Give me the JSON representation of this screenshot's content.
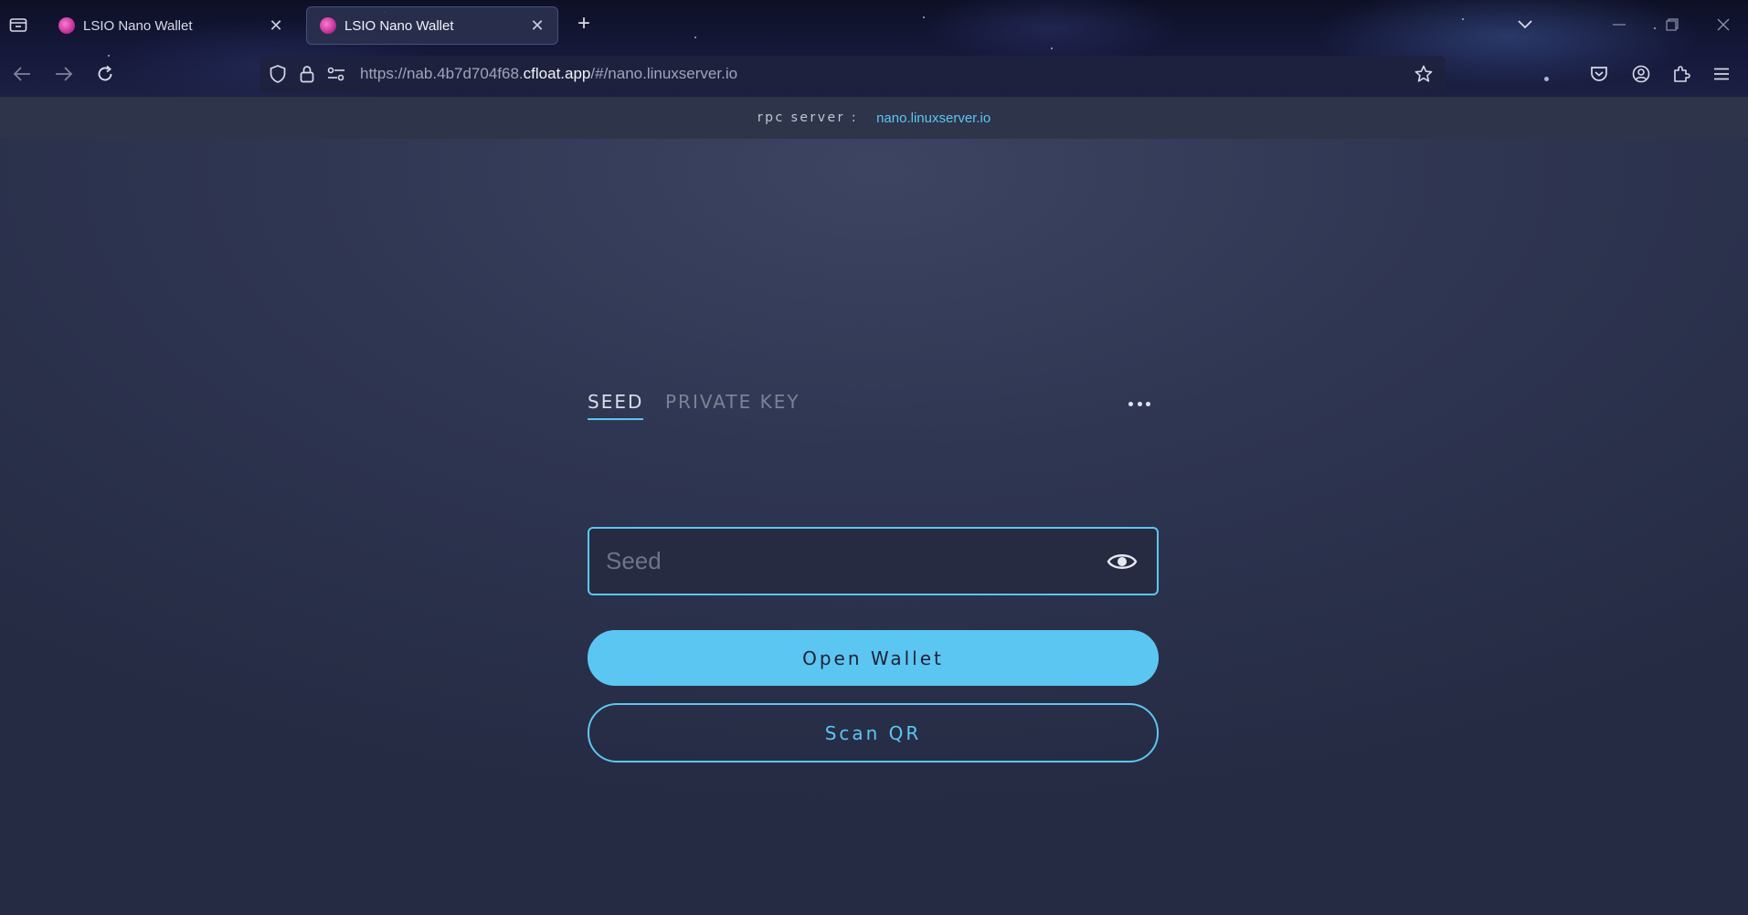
{
  "browser": {
    "tabs": [
      {
        "title": "LSIO Nano Wallet",
        "active": false
      },
      {
        "title": "LSIO Nano Wallet",
        "active": true
      }
    ],
    "url": {
      "prefix": "https://nab.4b7d704f68.",
      "host": "cfloat.app",
      "suffix": "/#/nano.linuxserver.io"
    }
  },
  "rpc": {
    "label": "rpc server :",
    "value": "nano.linuxserver.io"
  },
  "login": {
    "tabs": [
      {
        "label": "SEED",
        "active": true
      },
      {
        "label": "PRIVATE KEY",
        "active": false
      }
    ],
    "seed_placeholder": "Seed",
    "seed_value": "",
    "open_wallet_label": "Open Wallet",
    "scan_qr_label": "Scan QR"
  },
  "colors": {
    "accent": "#5cc6f2",
    "page_background": "#2f3652",
    "rpc_bar": "#2e3449"
  }
}
